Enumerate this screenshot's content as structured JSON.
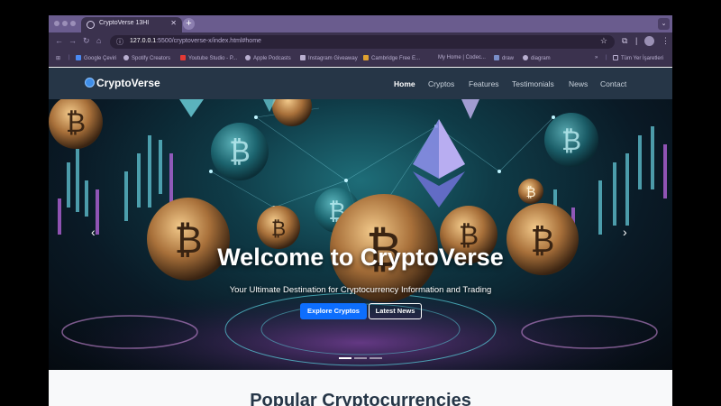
{
  "browser": {
    "tab_title": "CryptoVerse 13HI",
    "url_host": "127.0.0.1",
    "url_path": ":5500/cryptoverse-x/index.html#home",
    "bookmarks": [
      {
        "label": "Google Çeviri",
        "icon": "google-translate-icon",
        "color": "#4a8af4"
      },
      {
        "label": "Spotify Creators",
        "icon": "spotify-icon",
        "color": "#b9afd0"
      },
      {
        "label": "Youtube Studio - P...",
        "icon": "youtube-icon",
        "color": "#e53935"
      },
      {
        "label": "Apple Podcasts",
        "icon": "globe-icon",
        "color": "#b9afd0"
      },
      {
        "label": "Instagram Giveaway",
        "icon": "doc-icon",
        "color": "#b9afd0"
      },
      {
        "label": "Cambridge Free E...",
        "icon": "cambridge-icon",
        "color": "#e0a030"
      },
      {
        "label": "My Home | Codec...",
        "icon": "none",
        "color": ""
      },
      {
        "label": "draw",
        "icon": "draw-icon",
        "color": "#7a8ec8"
      },
      {
        "label": "diagram",
        "icon": "diagram-icon",
        "color": "#b9afd0"
      }
    ],
    "bookmarks_all": "Tüm Yer İşaretleri"
  },
  "site": {
    "brand": "CryptoVerse",
    "nav": [
      {
        "label": "Home",
        "active": true
      },
      {
        "label": "Cryptos",
        "active": false
      },
      {
        "label": "Features",
        "active": false
      },
      {
        "label": "Testimonials",
        "active": false
      },
      {
        "label": "News",
        "active": false
      },
      {
        "label": "Contact",
        "active": false
      }
    ]
  },
  "hero": {
    "title": "Welcome to CryptoVerse",
    "subtitle": "Your Ultimate Destination for Cryptocurrency Information and Trading",
    "primary_button": "Explore Cryptos",
    "secondary_button": "Latest News",
    "active_slide": 1,
    "slide_count": 3
  },
  "section": {
    "title": "Popular Cryptocurrencies"
  },
  "colors": {
    "nav_bg": "#263647",
    "primary": "#0d6efd",
    "browser_chrome": "#3b324e"
  }
}
